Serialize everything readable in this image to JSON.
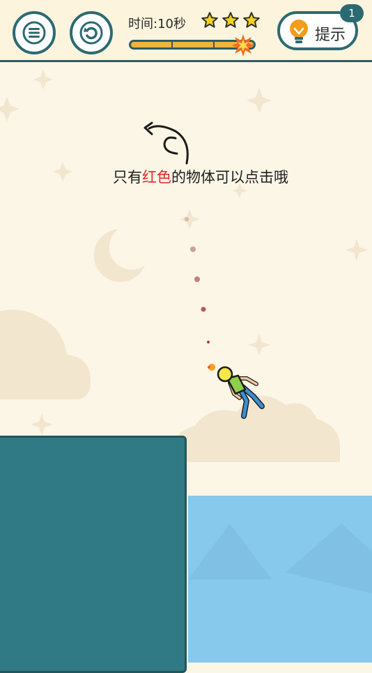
{
  "header": {
    "timer_text": "时间:10秒",
    "stars_count": 3,
    "hint_label": "提示",
    "hint_badge": "1"
  },
  "progress": {
    "value": 0.92
  },
  "instruction": {
    "prefix": "只有",
    "highlight": "红色",
    "suffix": "的物体可以点击哦"
  },
  "colors": {
    "background": "#fbf6e6",
    "teal": "#2c6a72",
    "platform": "#2f7a84",
    "water": "#86c9ec",
    "highlight": "#e0262b",
    "star": "#f5d21a"
  },
  "icons": [
    "menu-icon",
    "restart-icon",
    "star-icon",
    "lightbulb-icon",
    "explosion-icon",
    "moon-icon",
    "curved-arrow-icon"
  ]
}
